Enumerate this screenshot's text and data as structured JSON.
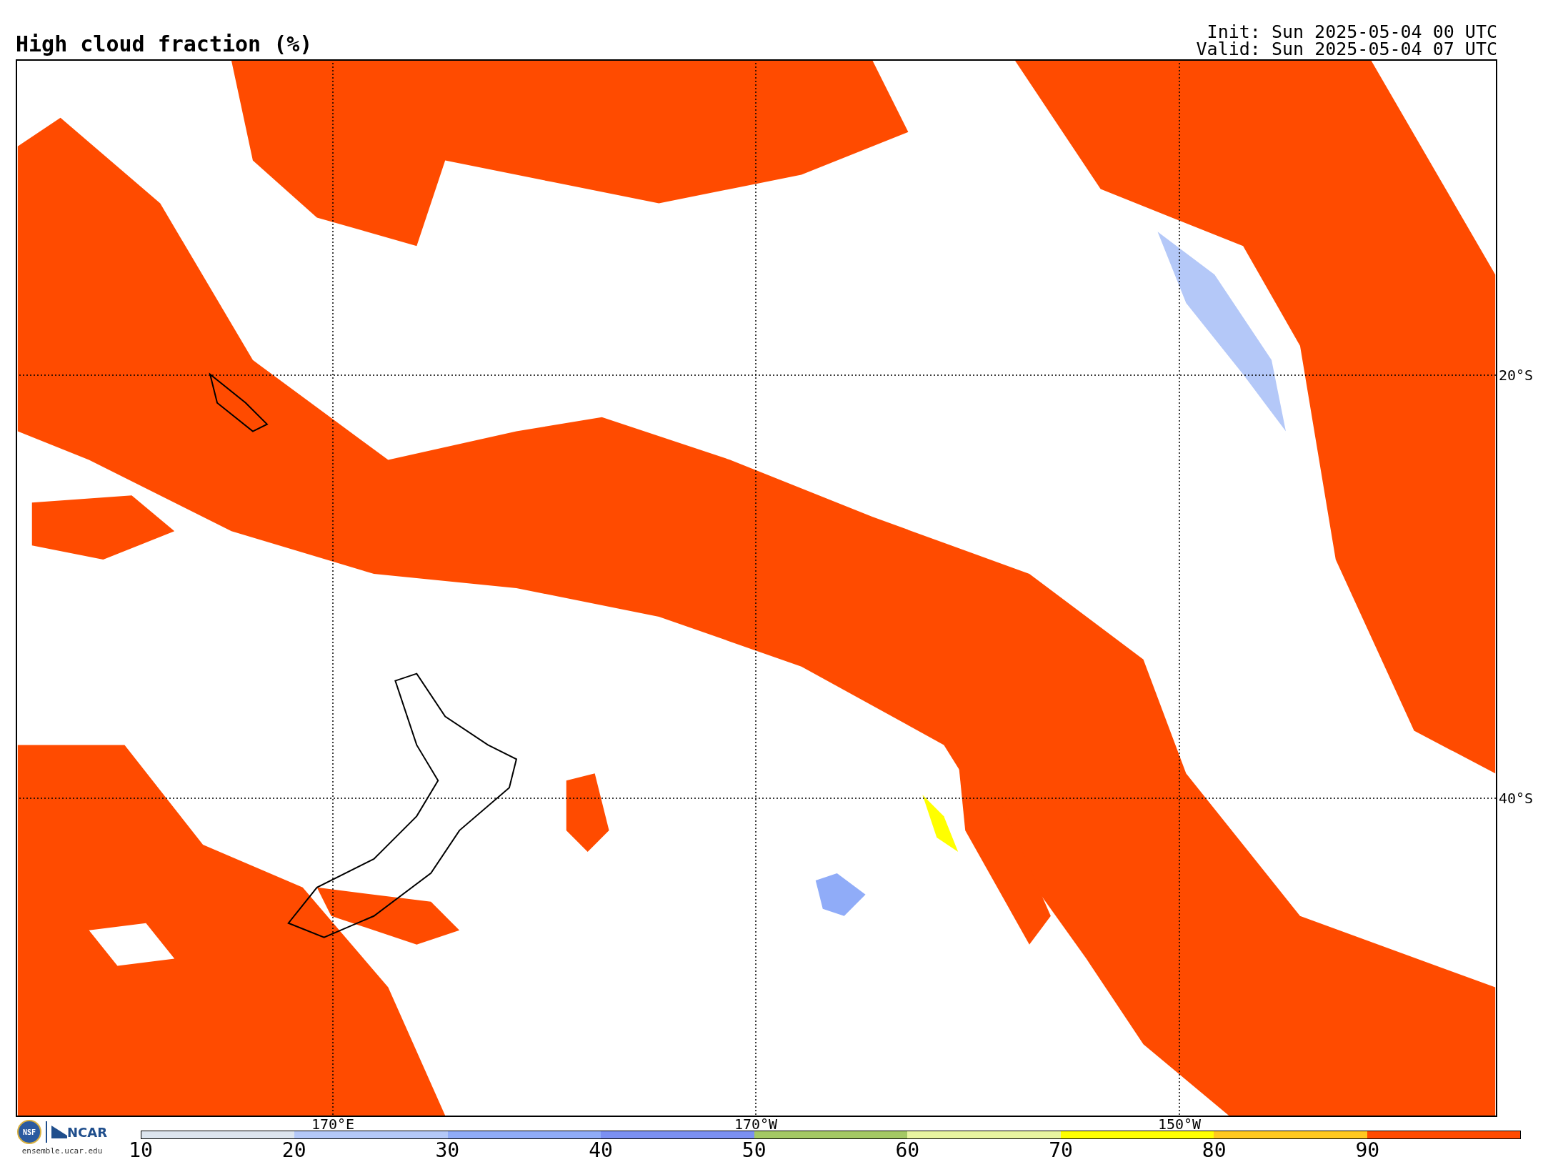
{
  "title": "High cloud fraction (%)",
  "init": "Init: Sun 2025-05-04 00 UTC",
  "valid": "Valid: Sun 2025-05-04 07 UTC",
  "latitude_labels": [
    "20°S",
    "40°S"
  ],
  "longitude_labels": [
    "170°E",
    "170°W",
    "150°W"
  ],
  "colorbar": {
    "segments": [
      {
        "color": "#dce4ee"
      },
      {
        "color": "#b4c8f8"
      },
      {
        "color": "#90acf8"
      },
      {
        "color": "#7b90f2"
      },
      {
        "color": "#a4c864"
      },
      {
        "color": "#e8f4a0"
      },
      {
        "color": "#ffff00"
      },
      {
        "color": "#ffc820"
      },
      {
        "color": "#ff4b00"
      }
    ],
    "labels": [
      "10",
      "20",
      "30",
      "40",
      "50",
      "60",
      "70",
      "80",
      "90"
    ]
  },
  "logo": {
    "nsf": "NSF",
    "ncar": "NCAR",
    "site": "ensemble.ucar.edu"
  }
}
